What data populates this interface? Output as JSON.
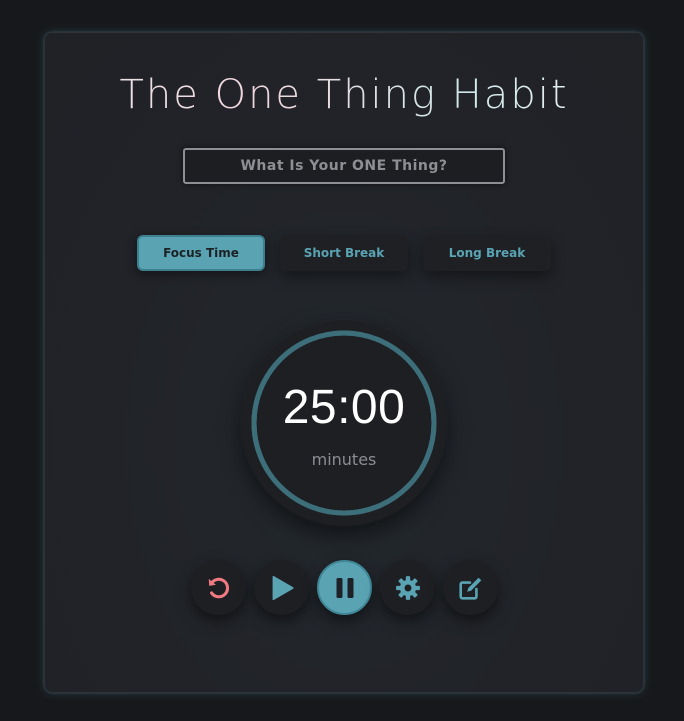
{
  "app": {
    "title": "The One Thing Habit"
  },
  "one_thing": {
    "placeholder": "What Is Your ONE Thing?",
    "value": ""
  },
  "modes": [
    {
      "label": "Focus Time",
      "active": true
    },
    {
      "label": "Short Break",
      "active": false
    },
    {
      "label": "Long Break",
      "active": false
    }
  ],
  "timer": {
    "time": "25:00",
    "unit": "minutes",
    "progress": 1.0
  },
  "controls": [
    {
      "icon": "reset-icon",
      "active": false
    },
    {
      "icon": "play-icon",
      "active": false
    },
    {
      "icon": "pause-icon",
      "active": true
    },
    {
      "icon": "gear-icon",
      "active": false
    },
    {
      "icon": "edit-icon",
      "active": false
    }
  ],
  "colors": {
    "accent": "#5aa3b3",
    "reset": "#f07a80",
    "background": "#212328",
    "ring": "#3d6f7b"
  }
}
